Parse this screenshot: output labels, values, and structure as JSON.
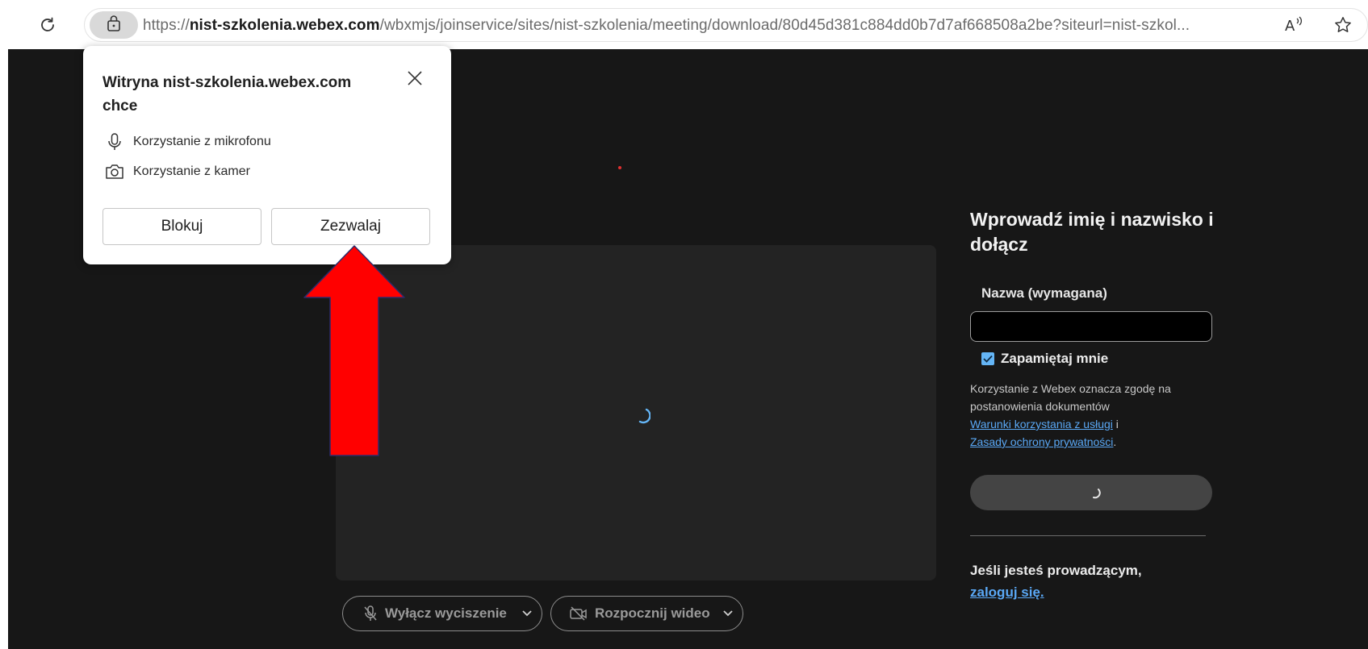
{
  "browser": {
    "url_prefix": "https://",
    "url_domain": "nist-szkolenia.webex.com",
    "url_path": "/wbxmjs/joinservice/sites/nist-szkolenia/meeting/download/80d45d381c884dd0b7d7af668508a2be?siteurl=nist-szkol...",
    "read_aloud_icon": "read-aloud-icon",
    "favorite_icon": "star-icon"
  },
  "permission_popup": {
    "title": "Witryna nist-szkolenia.webex.com chce",
    "permissions": [
      {
        "icon": "microphone-icon",
        "label": "Korzystanie z mikrofonu"
      },
      {
        "icon": "camera-icon",
        "label": "Korzystanie z kamer"
      }
    ],
    "block_label": "Blokuj",
    "allow_label": "Zezwalaj"
  },
  "annotation": {
    "arrow_color": "#ff0000",
    "arrow_target": "allow"
  },
  "join_panel": {
    "title": "Wprowadź imię i nazwisko i dołącz",
    "name_label": "Nazwa (wymagana)",
    "name_value": "",
    "remember_label": "Zapamiętaj mnie",
    "remember_checked": true,
    "terms_text": "Korzystanie z Webex oznacza zgodę na postanowienia dokumentów",
    "terms_link": "Warunki korzystania z usługi",
    "terms_and": "i",
    "privacy_link": "Zasady ochrony prywatności",
    "terms_end": ".",
    "host_text": "Jeśli jesteś prowadzącym,",
    "host_link": "zaloguj się."
  },
  "controls": {
    "mute_label": "Wyłącz wyciszenie",
    "video_label": "Rozpocznij wideo"
  },
  "colors": {
    "page_bg": "#171717",
    "preview_bg": "#232323",
    "link": "#5aa8f5",
    "checkbox": "#64b5f6",
    "join_button": "#444444"
  }
}
